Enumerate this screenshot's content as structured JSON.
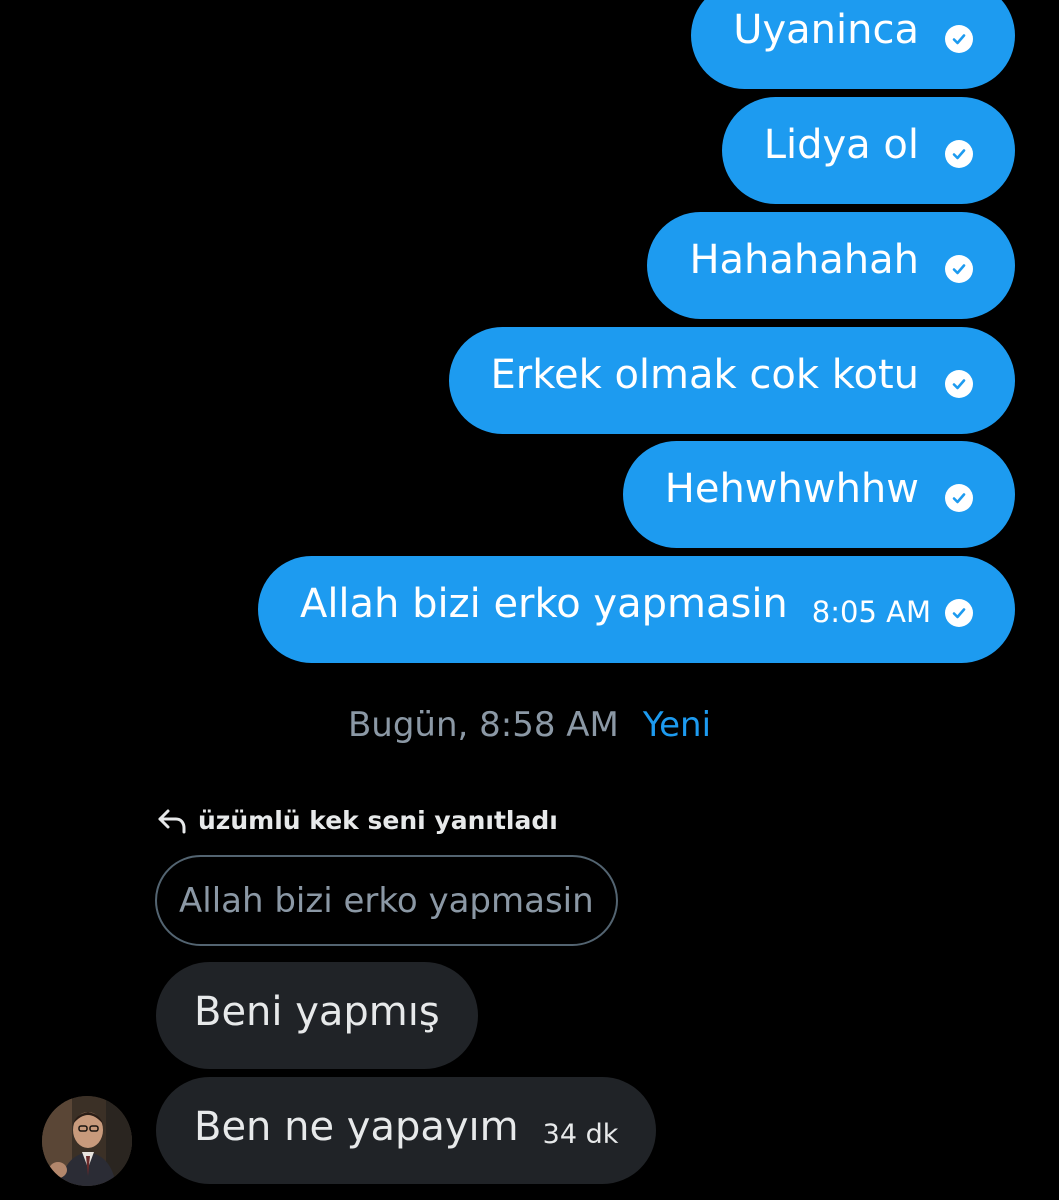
{
  "outgoing_messages": [
    {
      "text": "Uyaninca"
    },
    {
      "text": "Lidya ol"
    },
    {
      "text": "Hahahahah"
    },
    {
      "text": "Erkek olmak cok kotu"
    },
    {
      "text": "Hehwhwhhw"
    },
    {
      "text": "Allah bizi erko yapmasin",
      "time": "8:05 AM"
    }
  ],
  "divider": {
    "date_label": "Bugün, 8:58 AM",
    "new_label": "Yeni"
  },
  "reply": {
    "header": "üzümlü kek seni yanıtladı",
    "quoted_text": "Allah bizi erko yapmasin"
  },
  "incoming_messages": [
    {
      "text": "Beni yapmış"
    },
    {
      "text": "Ben ne yapayım",
      "time": "34 dk"
    }
  ],
  "icons": {
    "read_receipt": "check-circle-icon",
    "reply": "reply-arrow-icon"
  },
  "colors": {
    "background": "#000000",
    "outgoing_bubble": "#1d9bf0",
    "incoming_bubble": "#202327",
    "accent": "#1d9bf0",
    "muted_text": "#8b98a5"
  }
}
